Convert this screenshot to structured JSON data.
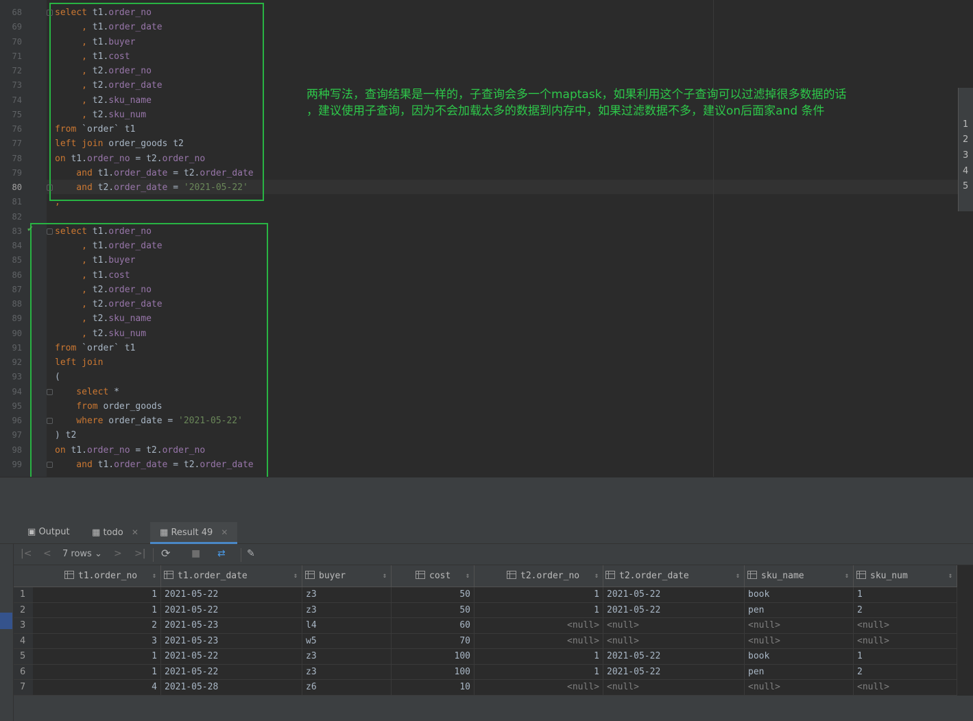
{
  "editor": {
    "current_line": 80,
    "line_numbers": [
      "68",
      "69",
      "70",
      "71",
      "72",
      "73",
      "74",
      "75",
      "76",
      "77",
      "78",
      "79",
      "80",
      "81",
      "82",
      "83",
      "84",
      "85",
      "86",
      "87",
      "88",
      "89",
      "90",
      "91",
      "92",
      "93",
      "94",
      "95",
      "96",
      "97",
      "98",
      "99"
    ],
    "q1": [
      [
        [
          "kw",
          "select"
        ],
        [
          "tx",
          " t1."
        ],
        [
          "fd",
          "order_no"
        ]
      ],
      [
        [
          "kw",
          "     , "
        ],
        [
          "tx",
          "t1."
        ],
        [
          "fd",
          "order_date"
        ]
      ],
      [
        [
          "kw",
          "     , "
        ],
        [
          "tx",
          "t1."
        ],
        [
          "fd",
          "buyer"
        ]
      ],
      [
        [
          "kw",
          "     , "
        ],
        [
          "tx",
          "t1."
        ],
        [
          "fd",
          "cost"
        ]
      ],
      [
        [
          "kw",
          "     , "
        ],
        [
          "tx",
          "t2."
        ],
        [
          "fd",
          "order_no"
        ]
      ],
      [
        [
          "kw",
          "     , "
        ],
        [
          "tx",
          "t2."
        ],
        [
          "fd",
          "order_date"
        ]
      ],
      [
        [
          "kw",
          "     , "
        ],
        [
          "tx",
          "t2."
        ],
        [
          "fd",
          "sku_name"
        ]
      ],
      [
        [
          "kw",
          "     , "
        ],
        [
          "tx",
          "t2."
        ],
        [
          "fd",
          "sku_num"
        ]
      ],
      [
        [
          "kw",
          "from"
        ],
        [
          "tx",
          " `order` t1"
        ]
      ],
      [
        [
          "kw",
          "left join"
        ],
        [
          "tx",
          " order_goods t2"
        ]
      ],
      [
        [
          "kw",
          "on"
        ],
        [
          "tx",
          " t1."
        ],
        [
          "fd",
          "order_no"
        ],
        [
          "tx",
          " = t2."
        ],
        [
          "fd",
          "order_no"
        ]
      ],
      [
        [
          "kw",
          "    and"
        ],
        [
          "tx",
          " t1."
        ],
        [
          "fd",
          "order_date"
        ],
        [
          "tx",
          " = t2."
        ],
        [
          "fd",
          "order_date"
        ]
      ],
      [
        [
          "kw",
          "    and"
        ],
        [
          "tx",
          " t2."
        ],
        [
          "fd",
          "order_date"
        ],
        [
          "tx",
          " = "
        ],
        [
          "st",
          "'2021-05-22'"
        ]
      ],
      [
        [
          "kw",
          ";"
        ]
      ]
    ],
    "q2": [
      [
        [
          "kw",
          "select"
        ],
        [
          "tx",
          " t1."
        ],
        [
          "fd",
          "order_no"
        ]
      ],
      [
        [
          "kw",
          "     , "
        ],
        [
          "tx",
          "t1."
        ],
        [
          "fd",
          "order_date"
        ]
      ],
      [
        [
          "kw",
          "     , "
        ],
        [
          "tx",
          "t1."
        ],
        [
          "fd",
          "buyer"
        ]
      ],
      [
        [
          "kw",
          "     , "
        ],
        [
          "tx",
          "t1."
        ],
        [
          "fd",
          "cost"
        ]
      ],
      [
        [
          "kw",
          "     , "
        ],
        [
          "tx",
          "t2."
        ],
        [
          "fd",
          "order_no"
        ]
      ],
      [
        [
          "kw",
          "     , "
        ],
        [
          "tx",
          "t2."
        ],
        [
          "fd",
          "order_date"
        ]
      ],
      [
        [
          "kw",
          "     , "
        ],
        [
          "tx",
          "t2."
        ],
        [
          "fd",
          "sku_name"
        ]
      ],
      [
        [
          "kw",
          "     , "
        ],
        [
          "tx",
          "t2."
        ],
        [
          "fd",
          "sku_num"
        ]
      ],
      [
        [
          "kw",
          "from"
        ],
        [
          "tx",
          " `order` t1"
        ]
      ],
      [
        [
          "kw",
          "left join"
        ]
      ],
      [
        [
          "tx",
          "("
        ]
      ],
      [
        [
          "kw",
          "    select"
        ],
        [
          "tx",
          " *"
        ]
      ],
      [
        [
          "kw",
          "    from"
        ],
        [
          "tx",
          " order_goods"
        ]
      ],
      [
        [
          "kw",
          "    where"
        ],
        [
          "tx",
          " order_date = "
        ],
        [
          "st",
          "'2021-05-22'"
        ]
      ],
      [
        [
          "tx",
          ") t2"
        ]
      ],
      [
        [
          "kw",
          "on"
        ],
        [
          "tx",
          " t1."
        ],
        [
          "fd",
          "order_no"
        ],
        [
          "tx",
          " = t2."
        ],
        [
          "fd",
          "order_no"
        ]
      ],
      [
        [
          "kw",
          "    and"
        ],
        [
          "tx",
          " t1."
        ],
        [
          "fd",
          "order_date"
        ],
        [
          "tx",
          " = t2."
        ],
        [
          "fd",
          "order_date"
        ]
      ]
    ],
    "note_line1": "两种写法，查询结果是一样的，子查询会多一个maptask，如果利用这个子查询可以过滤掉很多数据的话",
    "note_line2": "，建议使用子查询，因为不会加载太多的数据到内存中，如果过滤数据不多，建议on后面家and 条件",
    "right_panel_numbers": [
      "1",
      "2",
      "3",
      "4",
      "5"
    ]
  },
  "tabs": [
    {
      "label": "Output",
      "icon": "output-icon",
      "closable": false
    },
    {
      "label": "todo",
      "icon": "table-icon",
      "closable": true
    },
    {
      "label": "Result 49",
      "icon": "table-icon",
      "closable": true,
      "active": true
    }
  ],
  "toolbar": {
    "rows_label": "7 rows",
    "first": "first-page-icon",
    "prev": "prev-page-icon",
    "next": "next-page-icon",
    "last": "last-page-icon",
    "refresh": "refresh-icon",
    "stop": "stop-icon",
    "compare": "compare-icon",
    "pin": "pin-icon"
  },
  "grid": {
    "columns": [
      "t1.order_no",
      "t1.order_date",
      "buyer",
      "cost",
      "t2.order_no",
      "t2.order_date",
      "sku_name",
      "sku_num"
    ],
    "rows": [
      [
        "1",
        "2021-05-22",
        "z3",
        "50",
        "1",
        "2021-05-22",
        "book",
        "1"
      ],
      [
        "1",
        "2021-05-22",
        "z3",
        "50",
        "1",
        "2021-05-22",
        "pen",
        "2"
      ],
      [
        "2",
        "2021-05-23",
        "l4",
        "60",
        "<null>",
        "<null>",
        "<null>",
        "<null>"
      ],
      [
        "3",
        "2021-05-23",
        "w5",
        "70",
        "<null>",
        "<null>",
        "<null>",
        "<null>"
      ],
      [
        "1",
        "2021-05-22",
        "z3",
        "100",
        "1",
        "2021-05-22",
        "book",
        "1"
      ],
      [
        "1",
        "2021-05-22",
        "z3",
        "100",
        "1",
        "2021-05-22",
        "pen",
        "2"
      ],
      [
        "4",
        "2021-05-28",
        "z6",
        "10",
        "<null>",
        "<null>",
        "<null>",
        "<null>"
      ]
    ],
    "row_numbers": [
      "1",
      "2",
      "3",
      "4",
      "5",
      "6",
      "7"
    ]
  }
}
